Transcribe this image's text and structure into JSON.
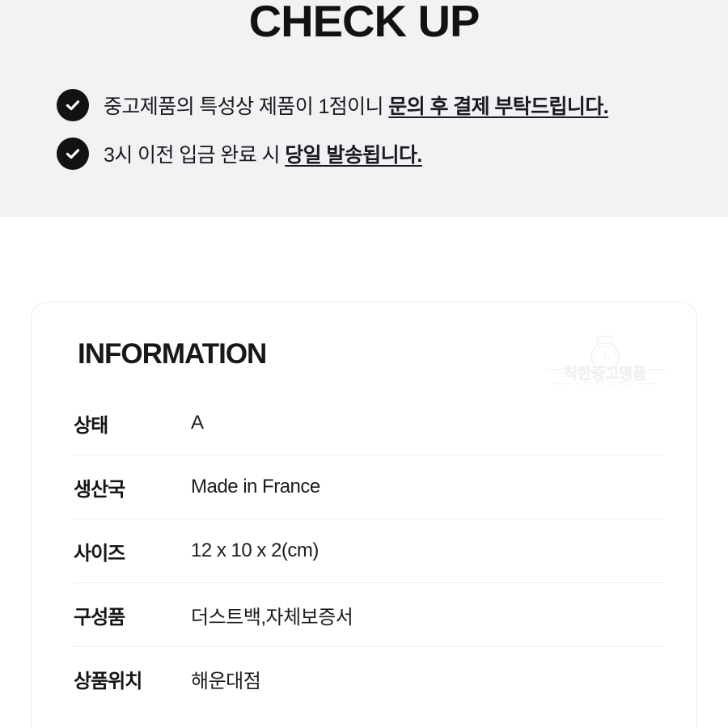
{
  "checkup": {
    "title": "CHECK UP",
    "items": [
      {
        "icon": "check-circle-icon",
        "text_plain": "중고제품의 특성상 제품이 1점이니 ",
        "text_emphasis": "문의 후 결제 부탁드립니다."
      },
      {
        "icon": "check-circle-icon",
        "text_plain": "3시 이전 입금 완료 시 ",
        "text_emphasis": "당일 발송됩니다."
      }
    ]
  },
  "information": {
    "heading": "INFORMATION",
    "watermark": {
      "icon": "watch-icon",
      "name": "착한중고명품",
      "subtitle": "LUXURY GOODS"
    },
    "rows": [
      {
        "label": "상태",
        "value": "A"
      },
      {
        "label": "생산국",
        "value": "Made in France"
      },
      {
        "label": "사이즈",
        "value": "12 x 10 x 2(cm)"
      },
      {
        "label": "구성품",
        "value": "더스트백,자체보증서"
      },
      {
        "label": "상품위치",
        "value": "해운대점"
      }
    ]
  },
  "colors": {
    "section_background": "#f1f2f4",
    "page_background": "#ffffff",
    "text_primary": "#141517",
    "icon_fill": "#111214",
    "divider": "#ebebeb",
    "card_border": "#eceded",
    "watermark": "#f0f0f0"
  }
}
